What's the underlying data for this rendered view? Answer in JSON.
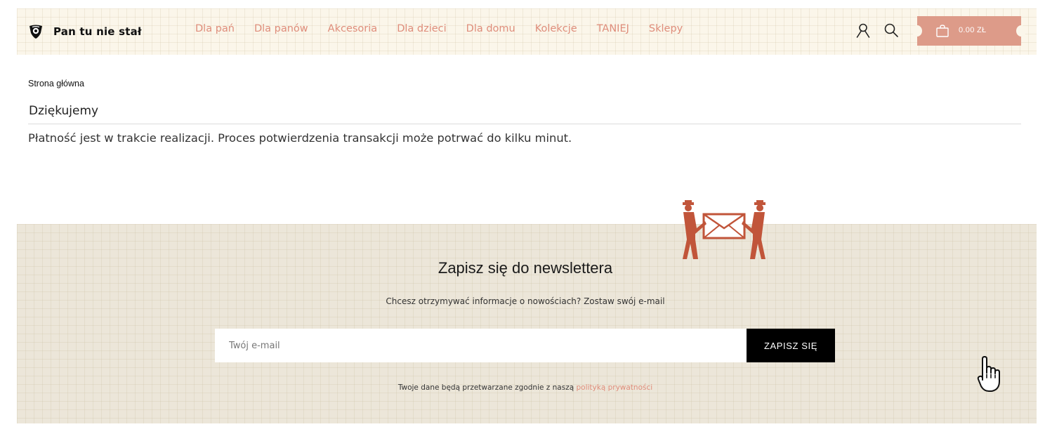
{
  "header": {
    "logo_text": "Pan tu nie stał",
    "nav": [
      "Dla pań",
      "Dla panów",
      "Akcesoria",
      "Dla dzieci",
      "Dla domu",
      "Kolekcje",
      "TANIEJ",
      "Sklepy"
    ],
    "icons": [
      "user-icon",
      "search-icon",
      "shopping-bag-icon"
    ],
    "cart_total": "0.00 ZŁ",
    "colors": {
      "accent": "#df8d7b",
      "cart": "#dd9b89",
      "header_bg": "#fbf6ea"
    }
  },
  "breadcrumb": {
    "home": "Strona główna"
  },
  "page": {
    "title": "Dziękujemy",
    "message": "Płatność jest w trakcie realizacji. Proces potwierdzenia transakcji może potrwać do kilku minut."
  },
  "newsletter": {
    "title": "Zapisz się do newslettera",
    "subtitle": "Chcesz otrzymywać informacje o nowościach? Zostaw swój e-mail",
    "email_placeholder": "Twój e-mail",
    "button_label": "ZAPISZ SIĘ",
    "privacy_text": "Twoje dane będą przetwarzane zgodnie z naszą ",
    "privacy_link": "polityką prywatności",
    "background": "#ece6d9"
  }
}
